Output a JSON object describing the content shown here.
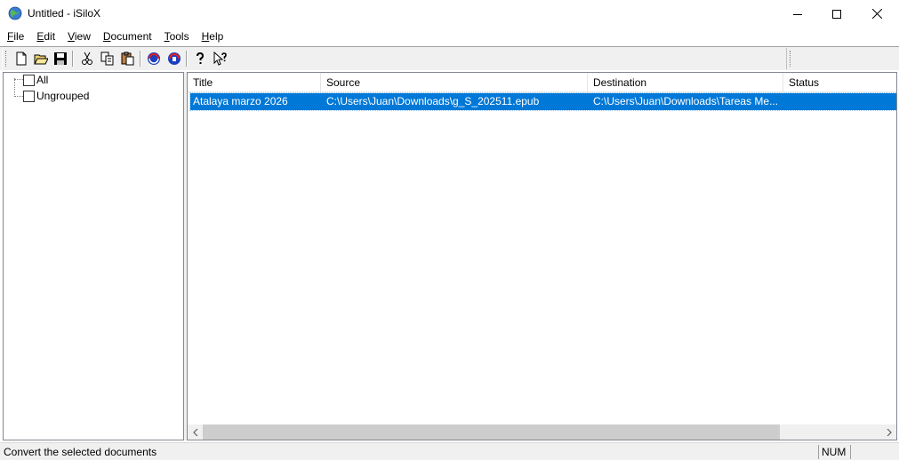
{
  "window": {
    "title": "Untitled - iSiloX",
    "app_icon": "isilox-globe-icon",
    "controls": [
      "minimize-icon",
      "maximize-icon",
      "close-icon"
    ]
  },
  "menu": {
    "items": [
      {
        "label_pre": "",
        "accel": "F",
        "label_post": "ile"
      },
      {
        "label_pre": "",
        "accel": "E",
        "label_post": "dit"
      },
      {
        "label_pre": "",
        "accel": "V",
        "label_post": "iew"
      },
      {
        "label_pre": "",
        "accel": "D",
        "label_post": "ocument"
      },
      {
        "label_pre": "",
        "accel": "T",
        "label_post": "ools"
      },
      {
        "label_pre": "",
        "accel": "H",
        "label_post": "elp"
      }
    ]
  },
  "toolbar": {
    "buttons": [
      "new-icon",
      "open-icon",
      "save-icon",
      "cut-icon",
      "copy-icon",
      "paste-icon",
      "convert-icon",
      "convert-all-icon",
      "help-icon",
      "context-help-icon"
    ]
  },
  "tree": {
    "items": [
      {
        "label": "All",
        "checked": false
      },
      {
        "label": "Ungrouped",
        "checked": false
      }
    ]
  },
  "list": {
    "columns": [
      "Title",
      "Source",
      "Destination",
      "Status"
    ],
    "rows": [
      {
        "title": "Atalaya marzo 2026",
        "source": "C:\\Users\\Juan\\Downloads\\g_S_202511.epub",
        "destination": "C:\\Users\\Juan\\Downloads\\Tareas Me...",
        "status": "",
        "selected": true
      }
    ]
  },
  "statusbar": {
    "message": "Convert the selected documents",
    "num_indicator": "NUM"
  },
  "colors": {
    "selection": "#0078d7",
    "chrome": "#f0f0f0"
  }
}
